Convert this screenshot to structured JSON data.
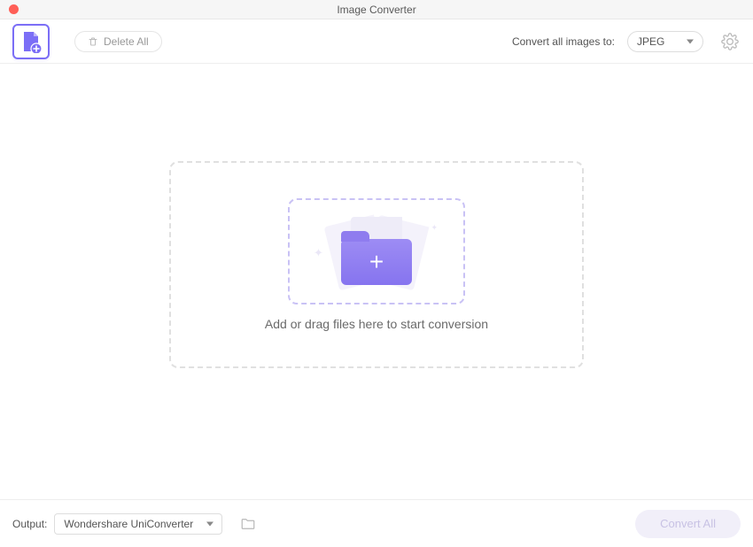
{
  "window": {
    "title": "Image Converter"
  },
  "toolbar": {
    "delete_all_label": "Delete All",
    "convert_to_label": "Convert all images to:",
    "format_selected": "JPEG"
  },
  "dropzone": {
    "text": "Add or drag files here to start conversion"
  },
  "footer": {
    "output_label": "Output:",
    "output_selected": "Wondershare UniConverter",
    "convert_all_label": "Convert All"
  }
}
